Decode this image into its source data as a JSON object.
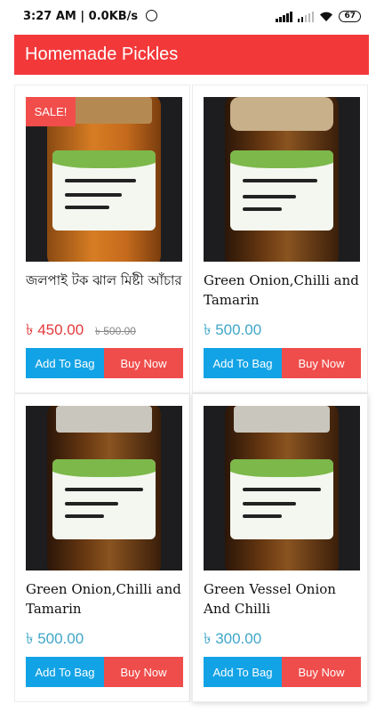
{
  "status": {
    "time": "3:27 AM",
    "speed": "0.0KB/s",
    "battery": "67"
  },
  "appbar": {
    "title": "Homemade Pickles"
  },
  "sale_badge": "SALE!",
  "buttons": {
    "add": "Add To Bag",
    "buy": "Buy Now"
  },
  "products": [
    {
      "name": "জলপাই টক ঝাল মিষ্টী আঁচার",
      "price": "৳ 450.00",
      "old_price": "৳ 500.00",
      "on_sale": true
    },
    {
      "name": "Green Onion,Chilli and Tamarin",
      "price": "৳ 500.00",
      "old_price": "",
      "on_sale": false
    },
    {
      "name": "Green Onion,Chilli and Tamarin",
      "price": "৳ 500.00",
      "old_price": "",
      "on_sale": false
    },
    {
      "name": "Green Vessel Onion And Chilli",
      "price": "৳ 300.00",
      "old_price": "",
      "on_sale": false
    }
  ],
  "colors": {
    "appbar": "#f3383a",
    "add_button": "#12a3e6",
    "buy_button": "#ef4d4b",
    "price": "#3fa6c8",
    "sale_price": "#e4393b"
  }
}
